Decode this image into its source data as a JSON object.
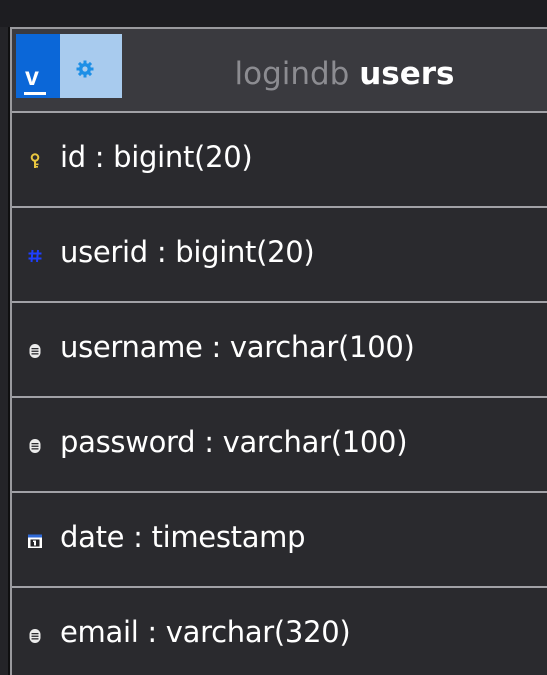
{
  "table": {
    "toggle_label": "v",
    "database": "logindb",
    "name": "users"
  },
  "columns": [
    {
      "name": "id",
      "type": "bigint(20)",
      "icon": "primary-key-icon",
      "label": "id : bigint(20)"
    },
    {
      "name": "userid",
      "type": "bigint(20)",
      "icon": "numeric-column-icon",
      "label": "userid : bigint(20)"
    },
    {
      "name": "username",
      "type": "varchar(100)",
      "icon": "text-column-icon",
      "label": "username : varchar(100)"
    },
    {
      "name": "password",
      "type": "varchar(100)",
      "icon": "text-column-icon",
      "label": "password : varchar(100)"
    },
    {
      "name": "date",
      "type": "timestamp",
      "icon": "calendar-column-icon",
      "label": "date : timestamp"
    },
    {
      "name": "email",
      "type": "varchar(320)",
      "icon": "text-column-icon",
      "label": "email : varchar(320)"
    }
  ],
  "colors": {
    "toggle_button": "#0b67d8",
    "settings_button": "#a8cbee",
    "settings_icon": "#1d8fe6",
    "key_icon": "#e8c640",
    "numeric_icon": "#1e3fff",
    "header_bg": "#3a3a3f",
    "row_bg": "#2a2a2e",
    "divider": "#a1a1a6"
  }
}
